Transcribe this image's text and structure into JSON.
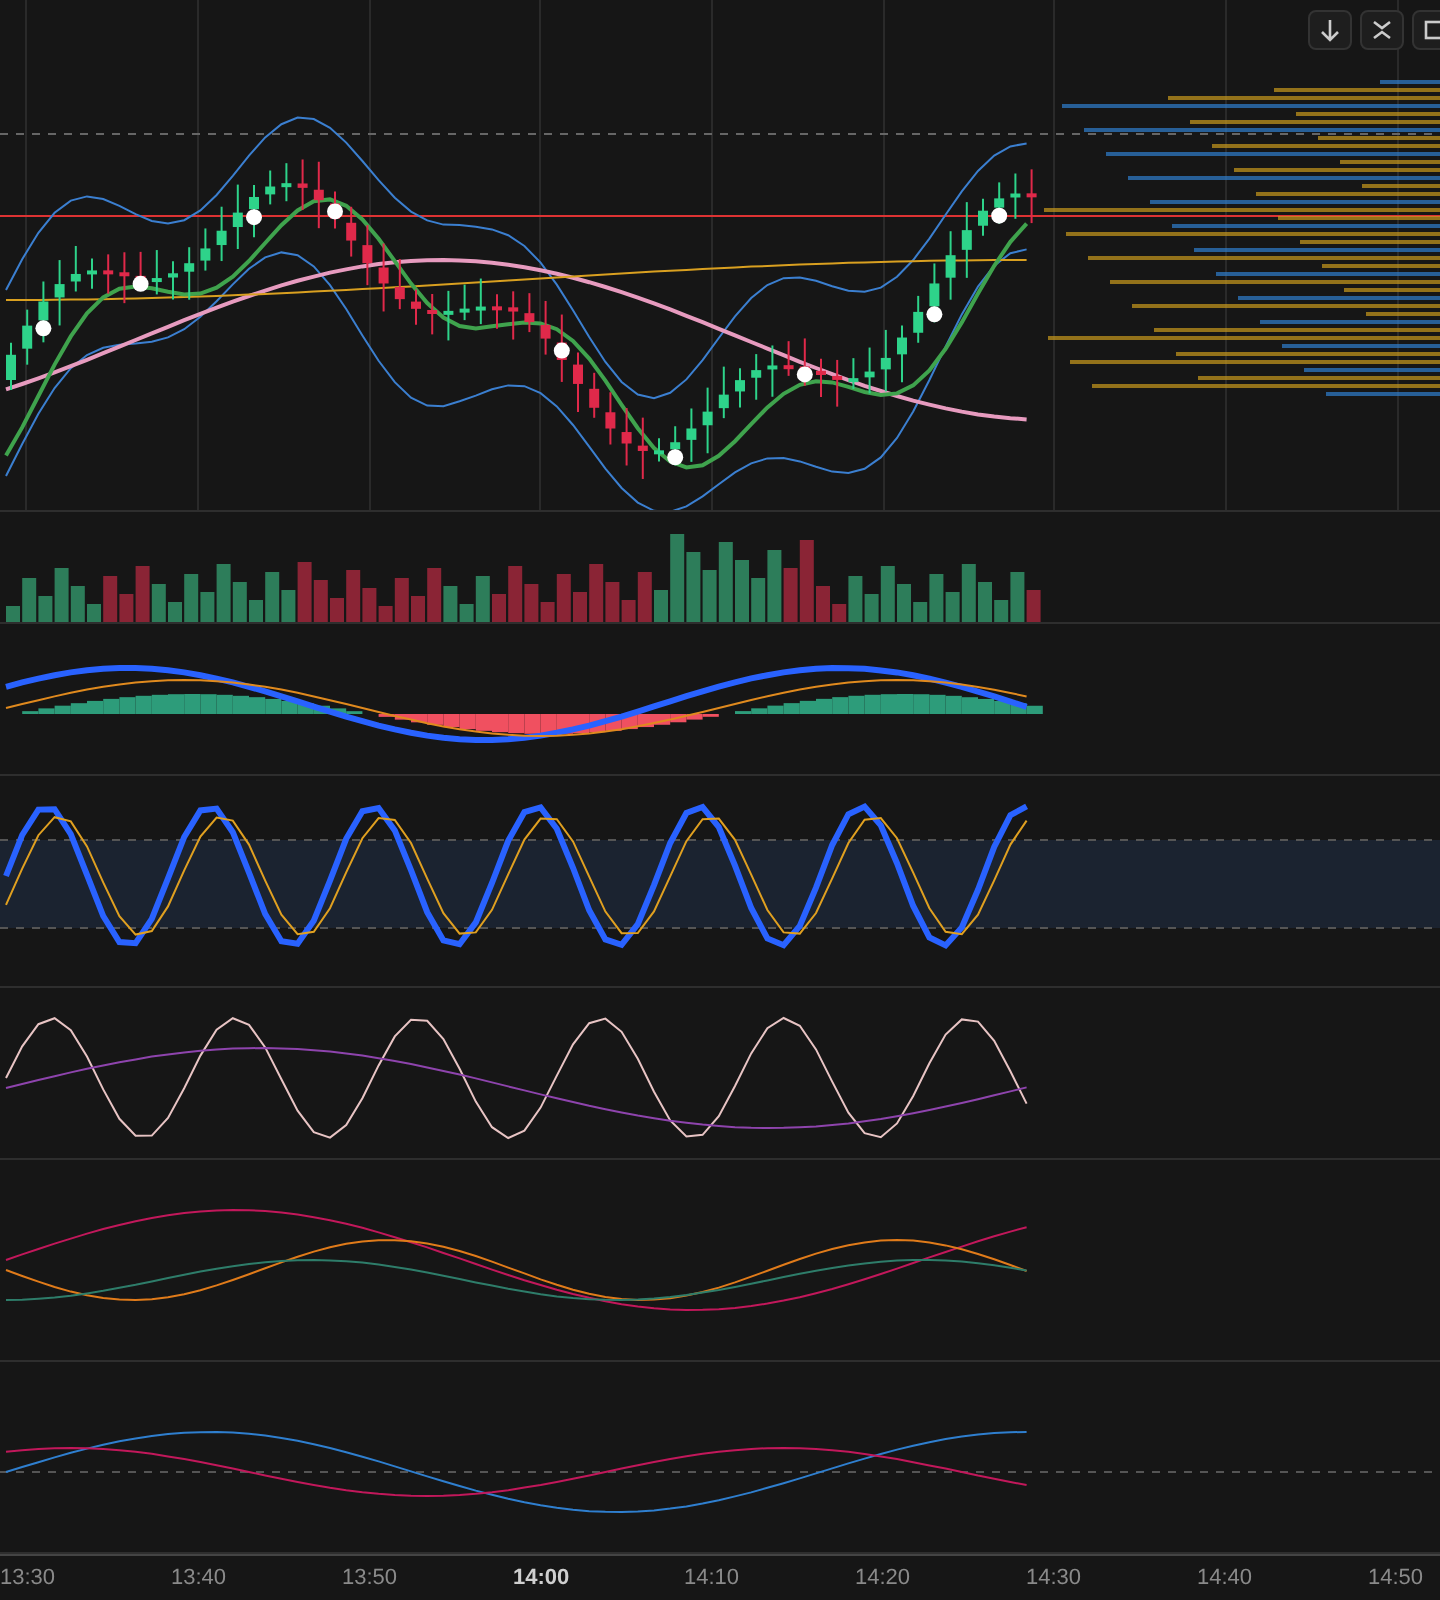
{
  "toolbar_buttons": [
    {
      "kind": "scroll-down"
    },
    {
      "kind": "collapse"
    },
    {
      "kind": "maximize"
    }
  ],
  "time_axis": [
    {
      "label": "13:30",
      "major": false
    },
    {
      "label": "13:40",
      "major": false
    },
    {
      "label": "13:50",
      "major": false
    },
    {
      "label": "14:00",
      "major": true
    },
    {
      "label": "14:10",
      "major": false
    },
    {
      "label": "14:20",
      "major": false
    },
    {
      "label": "14:30",
      "major": false
    },
    {
      "label": "14:40",
      "major": false
    },
    {
      "label": "14:50",
      "major": false
    }
  ]
}
